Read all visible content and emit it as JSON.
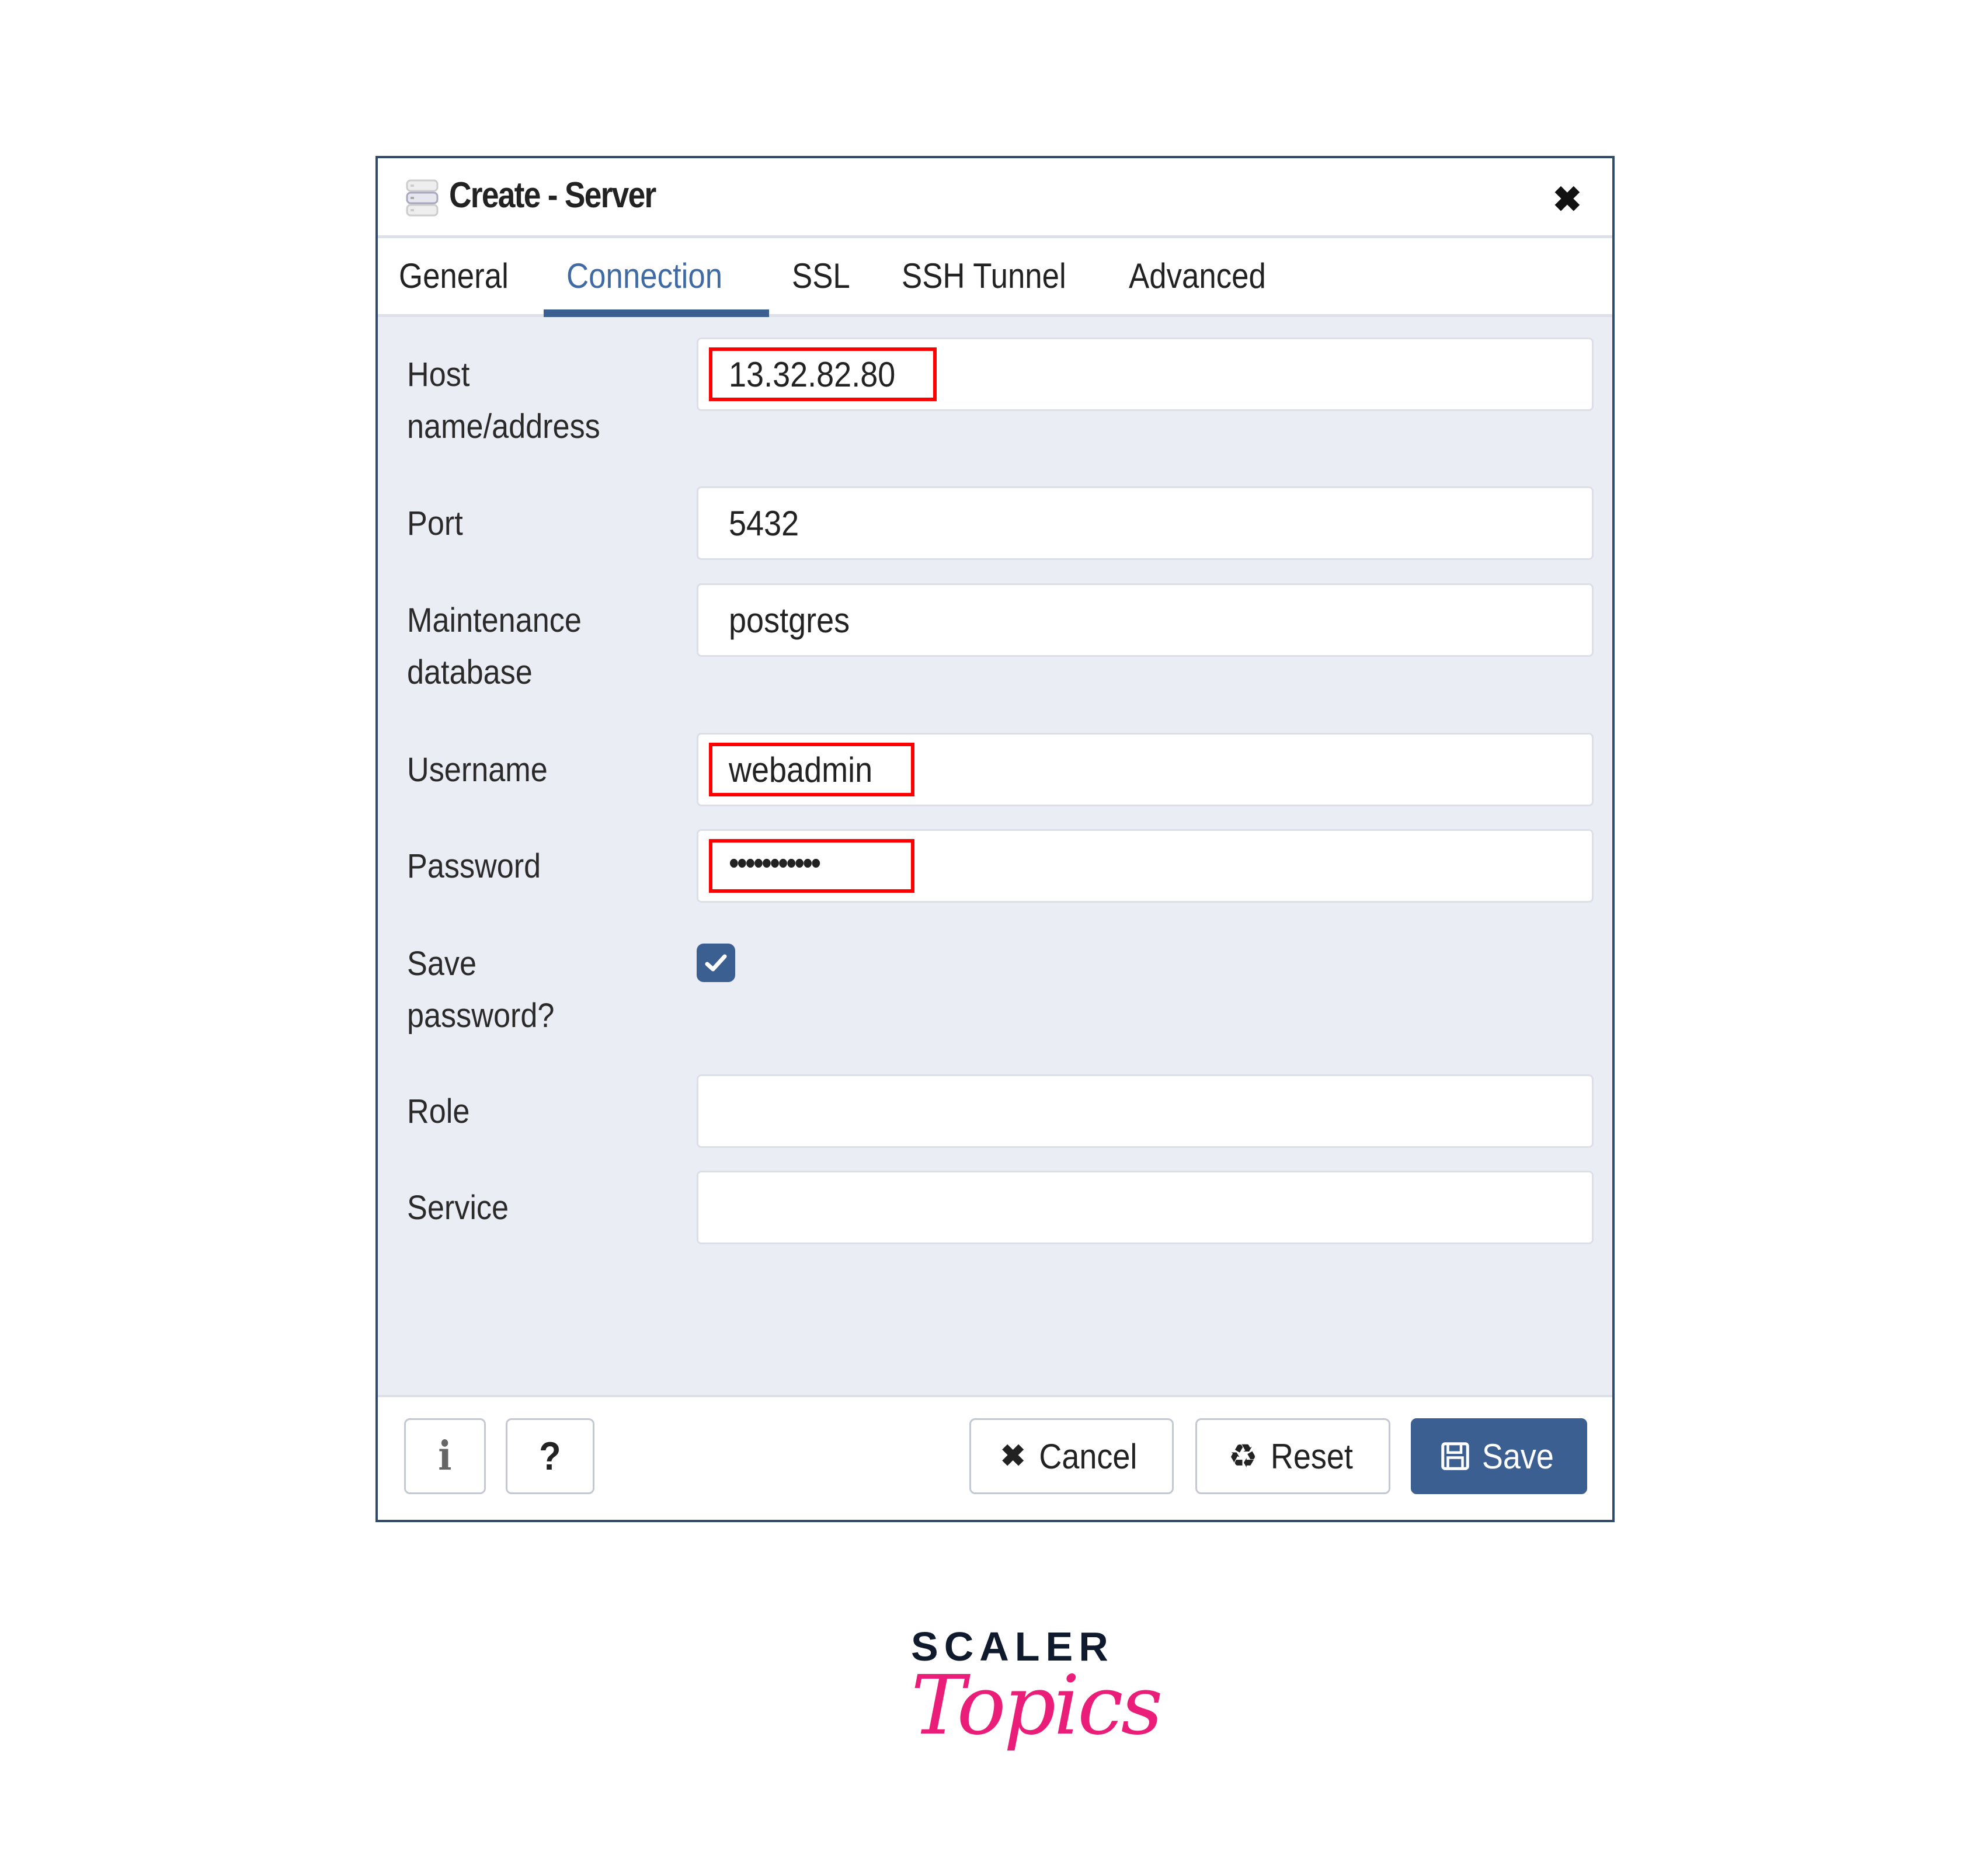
{
  "dialog": {
    "title": "Create - Server",
    "close_icon": "close-icon"
  },
  "tabs": [
    {
      "label": "General",
      "active": false
    },
    {
      "label": "Connection",
      "active": true
    },
    {
      "label": "SSL",
      "active": false
    },
    {
      "label": "SSH Tunnel",
      "active": false
    },
    {
      "label": "Advanced",
      "active": false
    }
  ],
  "form": {
    "host": {
      "label_line1": "Host",
      "label_line2": "name/address",
      "value": "13.32.82.80",
      "highlighted": true
    },
    "port": {
      "label": "Port",
      "value": "5432"
    },
    "maintenance_db": {
      "label_line1": "Maintenance",
      "label_line2": "database",
      "value": "postgres"
    },
    "username": {
      "label": "Username",
      "value": "webadmin",
      "highlighted": true
    },
    "password": {
      "label": "Password",
      "value": "•••••••••••",
      "highlighted": true
    },
    "save_password": {
      "label_line1": "Save",
      "label_line2": "password?",
      "checked": true
    },
    "role": {
      "label": "Role",
      "value": ""
    },
    "service": {
      "label": "Service",
      "value": ""
    }
  },
  "footer": {
    "info_label": "i",
    "help_label": "?",
    "cancel_label": "Cancel",
    "reset_label": "Reset",
    "save_label": "Save"
  },
  "brand": {
    "line1": "SCALER",
    "line2": "Topics",
    "colors": {
      "dark": "#0f1a2c",
      "pink": "#ea1e78"
    }
  },
  "colors": {
    "accent": "#3c5f92",
    "active_tab_text": "#3f6aa3",
    "highlight": "#ff0000",
    "panel_bg": "#ebedf5"
  }
}
